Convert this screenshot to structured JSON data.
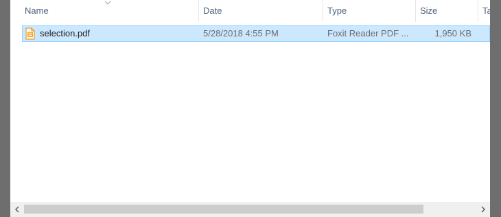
{
  "columns": {
    "name": "Name",
    "date": "Date",
    "type": "Type",
    "size": "Size",
    "tags": "Ta"
  },
  "file": {
    "name": "selection.pdf",
    "date": "5/28/2018 4:55 PM",
    "type": "Foxit Reader PDF ...",
    "size": "1,950 KB",
    "icon": "pdf-file-icon"
  },
  "colors": {
    "selection_bg": "#cce8ff",
    "selection_border": "#99d1ff",
    "header_text": "#4c607a",
    "frame": "#6e6e6e"
  }
}
